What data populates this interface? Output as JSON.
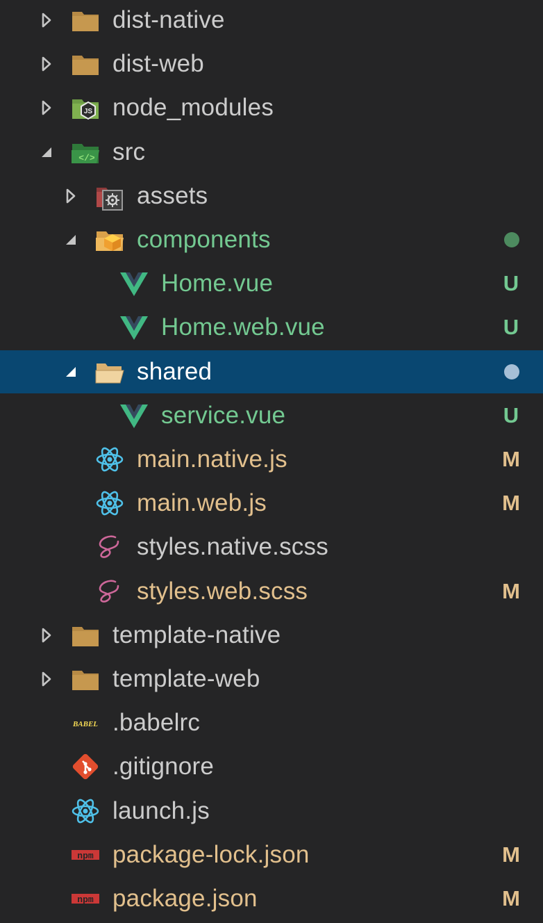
{
  "colors": {
    "background": "#252526",
    "selected_row": "#094771",
    "text_default": "#cccccc",
    "text_untracked": "#73c991",
    "text_modified": "#e2c08d",
    "badge_untracked": "#73c991",
    "badge_modified": "#e2c08d",
    "dot_untracked": "#4d8b5f",
    "dot_selected": "#a6bfd6"
  },
  "tree": [
    {
      "label": "dist-native",
      "icon": "folder-icon",
      "expand": "collapsed",
      "status": ""
    },
    {
      "label": "dist-web",
      "icon": "folder-icon",
      "expand": "collapsed",
      "status": ""
    },
    {
      "label": "node_modules",
      "icon": "node-folder-icon",
      "expand": "collapsed",
      "status": ""
    },
    {
      "label": "src",
      "icon": "src-folder-icon",
      "expand": "expanded",
      "status": ""
    },
    {
      "label": "assets",
      "icon": "assets-folder-icon",
      "expand": "collapsed",
      "status": ""
    },
    {
      "label": "components",
      "icon": "components-folder-icon",
      "expand": "expanded",
      "status": "untracked-dot"
    },
    {
      "label": "Home.vue",
      "icon": "vue-icon",
      "expand": "",
      "status": "U"
    },
    {
      "label": "Home.web.vue",
      "icon": "vue-icon",
      "expand": "",
      "status": "U"
    },
    {
      "label": "shared",
      "icon": "open-folder-icon",
      "expand": "expanded",
      "status": "selected-dot"
    },
    {
      "label": "service.vue",
      "icon": "vue-icon",
      "expand": "",
      "status": "U"
    },
    {
      "label": "main.native.js",
      "icon": "react-icon",
      "expand": "",
      "status": "M"
    },
    {
      "label": "main.web.js",
      "icon": "react-icon",
      "expand": "",
      "status": "M"
    },
    {
      "label": "styles.native.scss",
      "icon": "sass-icon",
      "expand": "",
      "status": ""
    },
    {
      "label": "styles.web.scss",
      "icon": "sass-icon",
      "expand": "",
      "status": "M"
    },
    {
      "label": "template-native",
      "icon": "folder-icon",
      "expand": "collapsed",
      "status": ""
    },
    {
      "label": "template-web",
      "icon": "folder-icon",
      "expand": "collapsed",
      "status": ""
    },
    {
      "label": ".babelrc",
      "icon": "babel-icon",
      "expand": "",
      "status": ""
    },
    {
      "label": ".gitignore",
      "icon": "git-icon",
      "expand": "",
      "status": ""
    },
    {
      "label": "launch.js",
      "icon": "react-icon",
      "expand": "",
      "status": ""
    },
    {
      "label": "package-lock.json",
      "icon": "npm-icon",
      "expand": "",
      "status": "M"
    },
    {
      "label": "package.json",
      "icon": "npm-icon",
      "expand": "",
      "status": "M"
    }
  ],
  "icon_texts": {
    "node_badge": "JS",
    "babel": "BABEL",
    "npm": "npm"
  }
}
